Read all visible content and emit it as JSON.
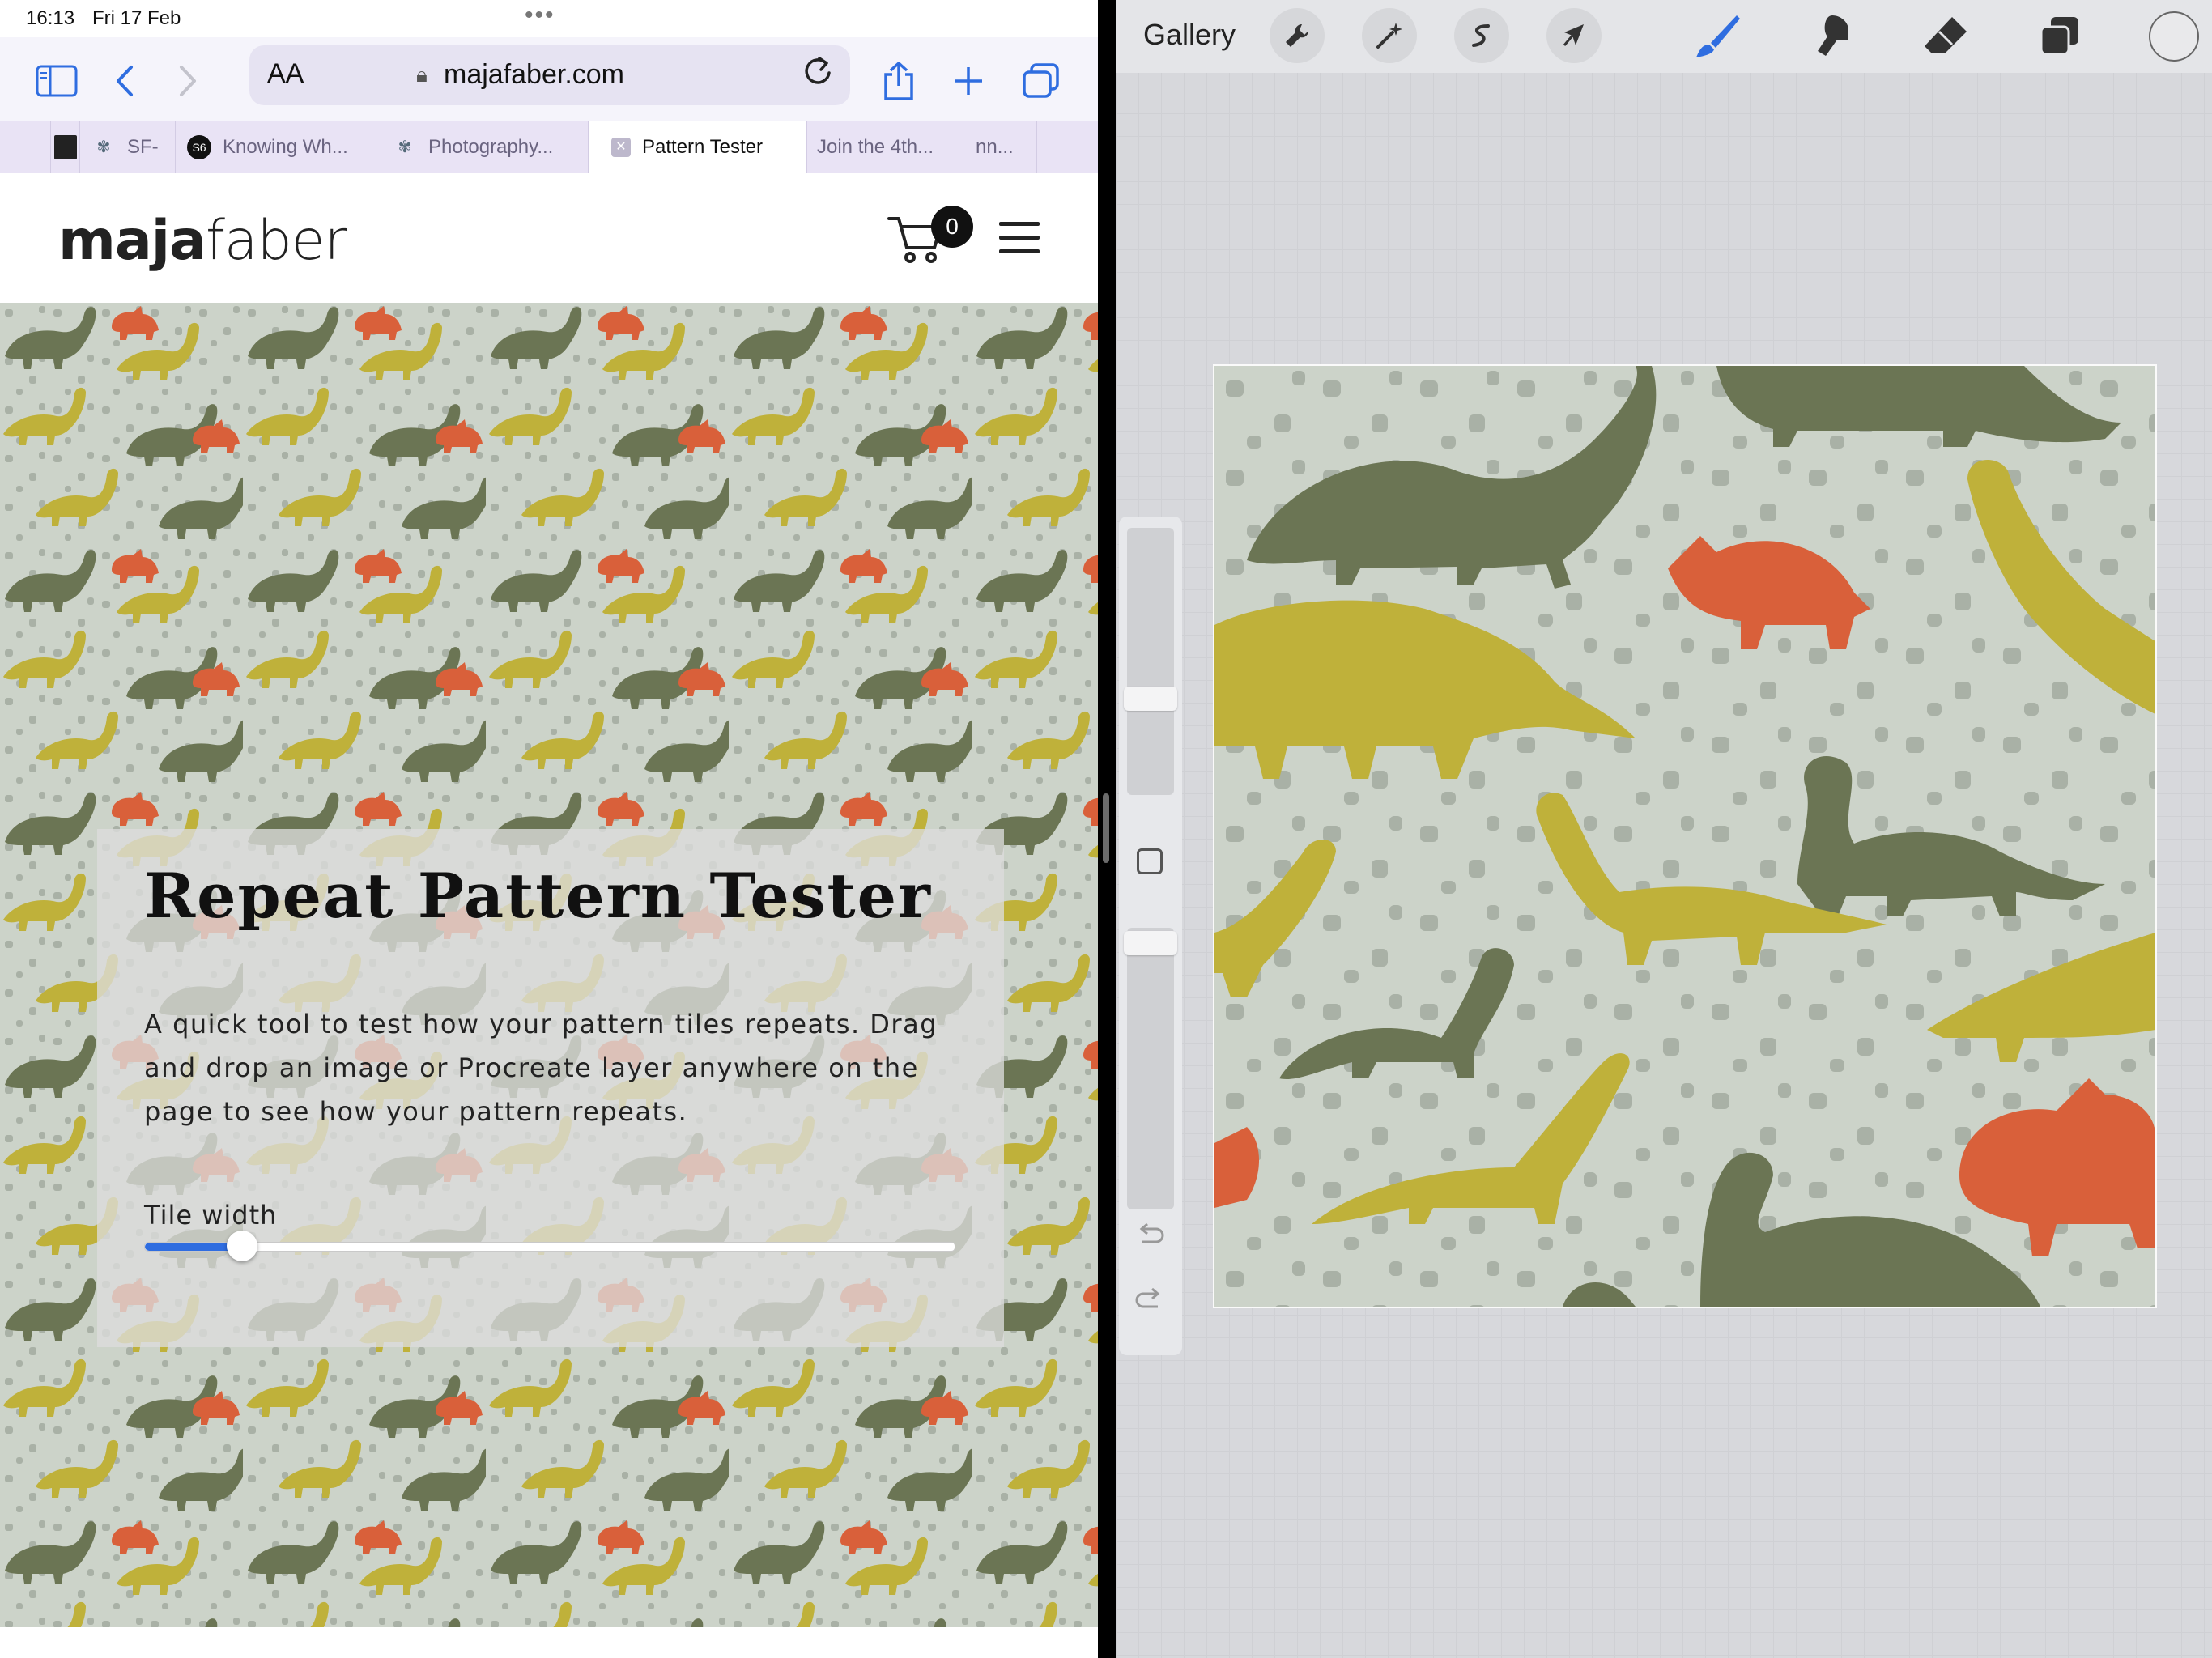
{
  "status": {
    "time": "16:13",
    "date": "Fri 17 Feb"
  },
  "browser": {
    "text_size_label": "AA",
    "domain": "majafaber.com",
    "tabs": [
      {
        "label": ""
      },
      {
        "label": "SF-"
      },
      {
        "label": "Knowing Wh..."
      },
      {
        "label": "Photography..."
      },
      {
        "label": "Pattern Tester",
        "active": true
      },
      {
        "label": "Join the 4th..."
      },
      {
        "label": "nn..."
      }
    ]
  },
  "site": {
    "logo_bold": "maja",
    "logo_light": "faber",
    "cart_count": "0"
  },
  "tester": {
    "title": "Repeat Pattern Tester",
    "description": "A quick tool to test how your pattern tiles repeats. Drag and drop an image or Procreate layer anywhere on the page to see how your pattern repeats.",
    "tile_width_label": "Tile width",
    "tile_width_fraction": 0.12
  },
  "procreate": {
    "gallery_label": "Gallery",
    "tools": [
      "wrench-icon",
      "magic-wand-icon",
      "adjust-icon",
      "selection-arrow-icon",
      "brush-icon",
      "smudge-icon",
      "eraser-icon",
      "layers-icon"
    ],
    "active_tool": "brush-icon"
  },
  "colors": {
    "accent": "#2f6de0",
    "pattern_bg": "#ccd3c9",
    "dino_dark": "#6b7554",
    "dino_yellow": "#bfb13a",
    "dino_orange": "#d9603a",
    "spot": "#a6aea3"
  }
}
